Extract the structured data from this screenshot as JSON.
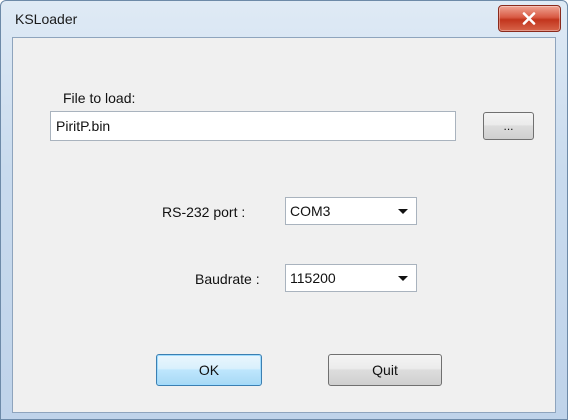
{
  "window": {
    "title": "KSLoader"
  },
  "file": {
    "label": "File to load:",
    "value": "PiritP.bin",
    "browse_label": "..."
  },
  "port": {
    "label": "RS-232 port :",
    "selected": "COM3"
  },
  "baud": {
    "label": "Baudrate :",
    "selected": "115200"
  },
  "actions": {
    "ok_label": "OK",
    "quit_label": "Quit"
  },
  "colors": {
    "close_button": "#c2351d",
    "default_button_border": "#3c7fb1",
    "dialog_background": "#f0f0f0"
  }
}
